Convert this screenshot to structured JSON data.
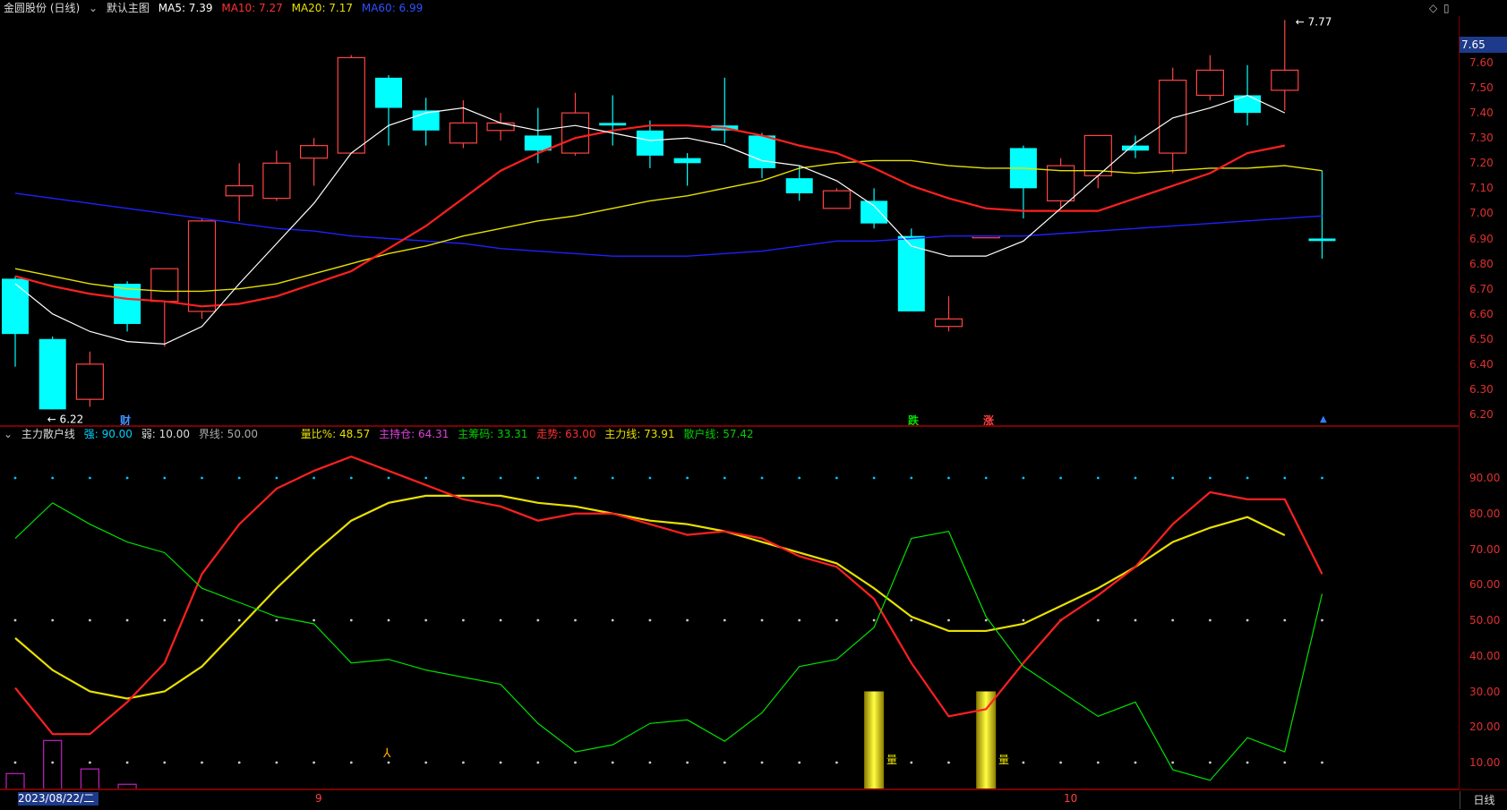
{
  "main_header": {
    "stock": "金圆股份 (日线)",
    "template": "默认主图",
    "ma5": "MA5: 7.39",
    "ma10": "MA10: 7.27",
    "ma20": "MA20: 7.17",
    "ma60": "MA60: 6.99"
  },
  "sub_header": {
    "indicator": "主力散户线",
    "strong": "强: 90.00",
    "weak": "弱: 10.00",
    "boundary": "界线: 50.00",
    "vol_ratio": "量比%: 48.57",
    "main_hold": "主持仓: 64.31",
    "main_chips": "主筹码: 33.31",
    "trend": "走势: 63.00",
    "main_line": "主力线: 73.91",
    "retail_line": "散户线: 57.42"
  },
  "price_badge": "7.65",
  "high_label": "7.77",
  "low_label": "6.22",
  "date_box": "2023/08/22/二",
  "period_button": "日线",
  "events": {
    "cai": "财",
    "die": "跌",
    "zhang": "涨",
    "liang": "量"
  },
  "month_labels": [
    "9",
    "10"
  ],
  "price_axis": [
    "7.60",
    "7.50",
    "7.40",
    "7.30",
    "7.20",
    "7.10",
    "7.00",
    "6.90",
    "6.80",
    "6.70",
    "6.60",
    "6.50",
    "6.40",
    "6.30",
    "6.20"
  ],
  "osc_axis": [
    "90.00",
    "80.00",
    "70.00",
    "60.00",
    "50.00",
    "40.00",
    "30.00",
    "20.00",
    "10.00"
  ],
  "colors": {
    "up": "#ff4444",
    "down": "#00ffff",
    "ma5": "#ffffff",
    "ma10": "#ff2020",
    "ma20": "#e8e000",
    "ma60": "#2020ff"
  },
  "chart_data": [
    {
      "type": "candlestick",
      "title": "金圆股份 (日线)",
      "ylim": [
        6.15,
        7.8
      ],
      "candles": [
        {
          "o": 6.74,
          "h": 6.75,
          "l": 6.39,
          "c": 6.52
        },
        {
          "o": 6.5,
          "h": 6.51,
          "l": 6.22,
          "c": 6.22
        },
        {
          "o": 6.26,
          "h": 6.45,
          "l": 6.23,
          "c": 6.4
        },
        {
          "o": 6.72,
          "h": 6.73,
          "l": 6.53,
          "c": 6.56
        },
        {
          "o": 6.65,
          "h": 6.78,
          "l": 6.47,
          "c": 6.78
        },
        {
          "o": 6.61,
          "h": 6.98,
          "l": 6.58,
          "c": 6.97
        },
        {
          "o": 7.07,
          "h": 7.2,
          "l": 6.97,
          "c": 7.11
        },
        {
          "o": 7.06,
          "h": 7.25,
          "l": 7.05,
          "c": 7.2
        },
        {
          "o": 7.22,
          "h": 7.3,
          "l": 7.11,
          "c": 7.27
        },
        {
          "o": 7.24,
          "h": 7.63,
          "l": 7.24,
          "c": 7.62
        },
        {
          "o": 7.54,
          "h": 7.55,
          "l": 7.27,
          "c": 7.42
        },
        {
          "o": 7.41,
          "h": 7.46,
          "l": 7.27,
          "c": 7.33
        },
        {
          "o": 7.28,
          "h": 7.45,
          "l": 7.26,
          "c": 7.36
        },
        {
          "o": 7.33,
          "h": 7.4,
          "l": 7.29,
          "c": 7.36
        },
        {
          "o": 7.31,
          "h": 7.42,
          "l": 7.2,
          "c": 7.25
        },
        {
          "o": 7.24,
          "h": 7.48,
          "l": 7.23,
          "c": 7.4
        },
        {
          "o": 7.36,
          "h": 7.47,
          "l": 7.27,
          "c": 7.35
        },
        {
          "o": 7.33,
          "h": 7.37,
          "l": 7.18,
          "c": 7.23
        },
        {
          "o": 7.22,
          "h": 7.24,
          "l": 7.11,
          "c": 7.2
        },
        {
          "o": 7.35,
          "h": 7.54,
          "l": 7.28,
          "c": 7.33
        },
        {
          "o": 7.31,
          "h": 7.32,
          "l": 7.14,
          "c": 7.18
        },
        {
          "o": 7.14,
          "h": 7.19,
          "l": 7.05,
          "c": 7.08
        },
        {
          "o": 7.02,
          "h": 7.1,
          "l": 7.02,
          "c": 7.09
        },
        {
          "o": 7.05,
          "h": 7.1,
          "l": 6.94,
          "c": 6.96
        },
        {
          "o": 6.91,
          "h": 6.94,
          "l": 6.61,
          "c": 6.61
        },
        {
          "o": 6.55,
          "h": 6.67,
          "l": 6.53,
          "c": 6.58
        },
        {
          "o": 6.91,
          "h": 6.91,
          "l": 6.91,
          "c": 6.91
        },
        {
          "o": 7.26,
          "h": 7.27,
          "l": 6.98,
          "c": 7.1
        },
        {
          "o": 7.05,
          "h": 7.22,
          "l": 7.02,
          "c": 7.19
        },
        {
          "o": 7.15,
          "h": 7.31,
          "l": 7.1,
          "c": 7.31
        },
        {
          "o": 7.27,
          "h": 7.31,
          "l": 7.22,
          "c": 7.25
        },
        {
          "o": 7.24,
          "h": 7.58,
          "l": 7.16,
          "c": 7.53
        },
        {
          "o": 7.47,
          "h": 7.63,
          "l": 7.45,
          "c": 7.57
        },
        {
          "o": 7.47,
          "h": 7.59,
          "l": 7.35,
          "c": 7.4
        },
        {
          "o": 7.49,
          "h": 7.77,
          "l": 7.41,
          "c": 7.57
        },
        {
          "o": 6.9,
          "h": 7.17,
          "l": 6.82,
          "c": 6.89
        }
      ],
      "ma5": [
        6.72,
        6.6,
        6.53,
        6.49,
        6.48,
        6.55,
        6.72,
        6.88,
        7.04,
        7.24,
        7.35,
        7.4,
        7.42,
        7.36,
        7.33,
        7.35,
        7.32,
        7.29,
        7.3,
        7.27,
        7.21,
        7.19,
        7.13,
        7.03,
        6.87,
        6.83,
        6.83,
        6.89,
        7.02,
        7.15,
        7.28,
        7.38,
        7.42,
        7.47,
        7.4
      ],
      "ma10": [
        6.75,
        6.71,
        6.68,
        6.66,
        6.65,
        6.63,
        6.64,
        6.67,
        6.72,
        6.77,
        6.86,
        6.95,
        7.06,
        7.17,
        7.24,
        7.3,
        7.33,
        7.35,
        7.35,
        7.34,
        7.31,
        7.27,
        7.24,
        7.18,
        7.11,
        7.06,
        7.02,
        7.01,
        7.01,
        7.01,
        7.06,
        7.11,
        7.16,
        7.24,
        7.27
      ],
      "ma20": [
        6.78,
        6.75,
        6.72,
        6.7,
        6.69,
        6.69,
        6.7,
        6.72,
        6.76,
        6.8,
        6.84,
        6.87,
        6.91,
        6.94,
        6.97,
        6.99,
        7.02,
        7.05,
        7.07,
        7.1,
        7.13,
        7.18,
        7.2,
        7.21,
        7.21,
        7.19,
        7.18,
        7.18,
        7.17,
        7.17,
        7.16,
        7.17,
        7.18,
        7.18,
        7.19,
        7.17
      ],
      "ma60": [
        7.08,
        7.06,
        7.04,
        7.02,
        7.0,
        6.98,
        6.96,
        6.94,
        6.93,
        6.91,
        6.9,
        6.89,
        6.88,
        6.86,
        6.85,
        6.84,
        6.83,
        6.83,
        6.83,
        6.84,
        6.85,
        6.87,
        6.89,
        6.89,
        6.9,
        6.91,
        6.91,
        6.91,
        6.92,
        6.93,
        6.94,
        6.95,
        6.96,
        6.97,
        6.98,
        6.99
      ]
    },
    {
      "type": "line",
      "title": "主力散户线",
      "ylim": [
        0,
        100
      ],
      "series": [
        {
          "name": "主力线",
          "color": "#e8e000",
          "values": [
            45,
            36,
            30,
            28,
            30,
            37,
            48,
            59,
            69,
            78,
            83,
            85,
            85,
            85,
            83,
            82,
            80,
            78,
            77,
            75,
            72,
            69,
            66,
            59,
            51,
            47,
            47,
            49,
            54,
            59,
            65,
            72,
            76,
            79,
            73.91
          ]
        },
        {
          "name": "走势",
          "color": "#ff2020",
          "values": [
            31,
            18,
            18,
            27,
            38,
            63,
            77,
            87,
            92,
            96,
            92,
            88,
            84,
            82,
            78,
            80,
            80,
            77,
            74,
            75,
            73,
            68,
            65,
            56,
            38,
            23,
            25,
            38,
            50,
            57,
            65,
            77,
            86,
            84,
            84,
            63
          ]
        },
        {
          "name": "散户线",
          "color": "#00e000",
          "values": [
            73,
            83,
            77,
            72,
            69,
            59,
            55,
            51,
            49,
            38,
            39,
            36,
            34,
            32,
            21,
            13,
            15,
            21,
            22,
            16,
            24,
            37,
            39,
            48,
            73,
            75,
            51,
            37,
            30,
            23,
            27,
            8,
            5,
            17,
            13,
            57.42
          ]
        }
      ],
      "volume_ratio_bars": [
        6.9,
        16.2,
        8.2,
        3.9,
        2.0,
        0.9,
        0.6,
        0.4,
        0.3,
        0.3,
        0.3,
        0.3,
        0.3,
        0.3,
        0.3,
        0.3,
        0.3,
        0.3,
        0.3,
        0.3,
        0.3,
        0.3,
        0.3,
        0.3,
        0.3,
        0.3,
        0.3,
        0.3,
        0.3,
        0.3,
        0.3,
        0.3,
        0.3,
        0.3,
        0.3,
        0.3
      ],
      "highlight_bars": [
        {
          "index": 23,
          "value": 30
        },
        {
          "index": 26,
          "value": 30
        }
      ]
    }
  ]
}
